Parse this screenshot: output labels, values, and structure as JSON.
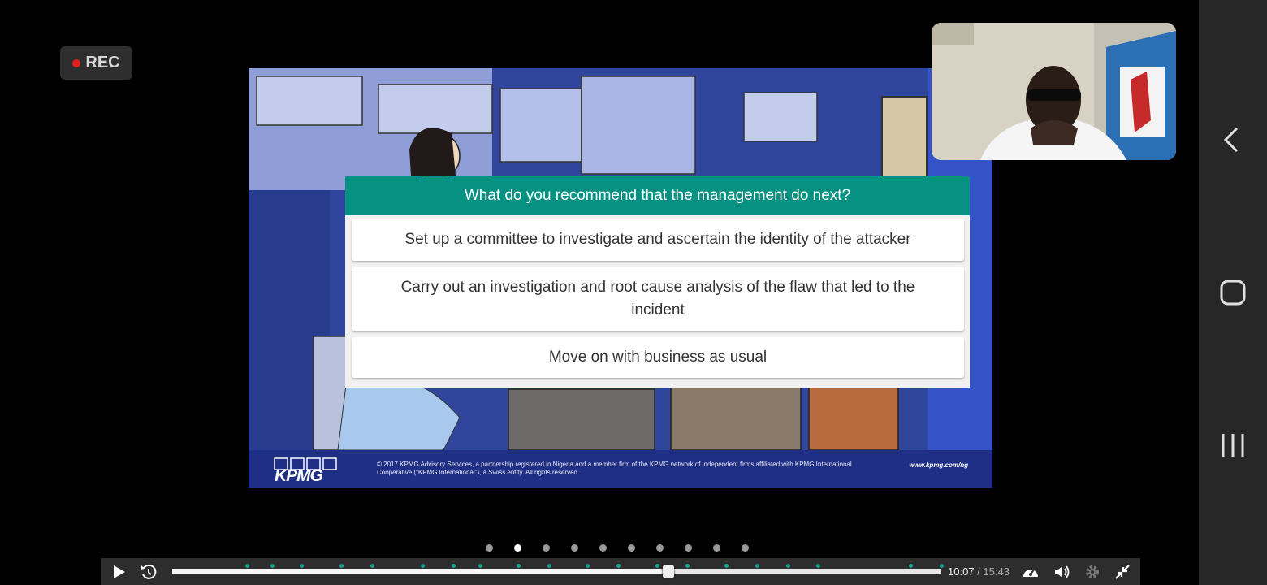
{
  "recording": {
    "label": "REC"
  },
  "slide": {
    "question": "What do you recommend that the management do next?",
    "options": [
      "Set up a committee to investigate and ascertain the identity of the attacker",
      "Carry out an investigation and root cause analysis of the flaw that led to the incident",
      "Move on with business as usual"
    ],
    "footer": {
      "logo_text": "KPMG",
      "copyright": "© 2017 KPMG Advisory Services, a partnership registered in Nigeria and a member firm of the KPMG network of independent firms affiliated with KPMG International Cooperative (\"KPMG International\"), a Swiss entity. All rights reserved.",
      "url": "www.kpmg.com/ng"
    }
  },
  "pagination": {
    "count": 10,
    "active_index": 1
  },
  "player": {
    "current_time": "10:07",
    "separator": " / ",
    "total_time": "15:43",
    "progress_fraction": 0.645,
    "marker_fractions": [
      0.097,
      0.13,
      0.168,
      0.22,
      0.26,
      0.325,
      0.365,
      0.4,
      0.45,
      0.49,
      0.54,
      0.58,
      0.63,
      0.67,
      0.72,
      0.76,
      0.8,
      0.84,
      0.96,
      1.0
    ],
    "accent_color": "#13a38f"
  },
  "icons": {
    "play": "play-icon",
    "replay": "replay-10-icon",
    "speed": "speed-gauge-icon",
    "volume": "volume-icon",
    "settings": "gear-icon",
    "exit_fullscreen": "exit-fullscreen-icon"
  },
  "android_nav": [
    "back-icon",
    "home-icon",
    "recents-icon"
  ]
}
